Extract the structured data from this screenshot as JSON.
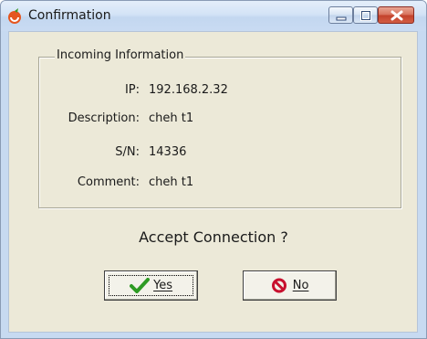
{
  "window": {
    "title": "Confirmation",
    "controls": {
      "minimize": "minimize",
      "maximize": "maximize",
      "close": "close"
    }
  },
  "group": {
    "legend": "Incoming Information",
    "fields": [
      {
        "label": "IP:",
        "value": "192.168.2.32"
      },
      {
        "label": "Description:",
        "value": "cheh t1"
      },
      {
        "label": "S/N:",
        "value": "14336"
      },
      {
        "label": "Comment:",
        "value": "cheh t1"
      }
    ]
  },
  "question": "Accept Connection ?",
  "buttons": {
    "yes": {
      "label": "Yes",
      "icon": "checkmark-icon",
      "icon_color": "#2e9b24"
    },
    "no": {
      "label": "No",
      "icon": "no-entry-icon",
      "icon_color": "#c8102e"
    }
  },
  "colors": {
    "title_bar": "#d3e3f6",
    "client": "#ece9d8",
    "close_button": "#c3412b"
  }
}
